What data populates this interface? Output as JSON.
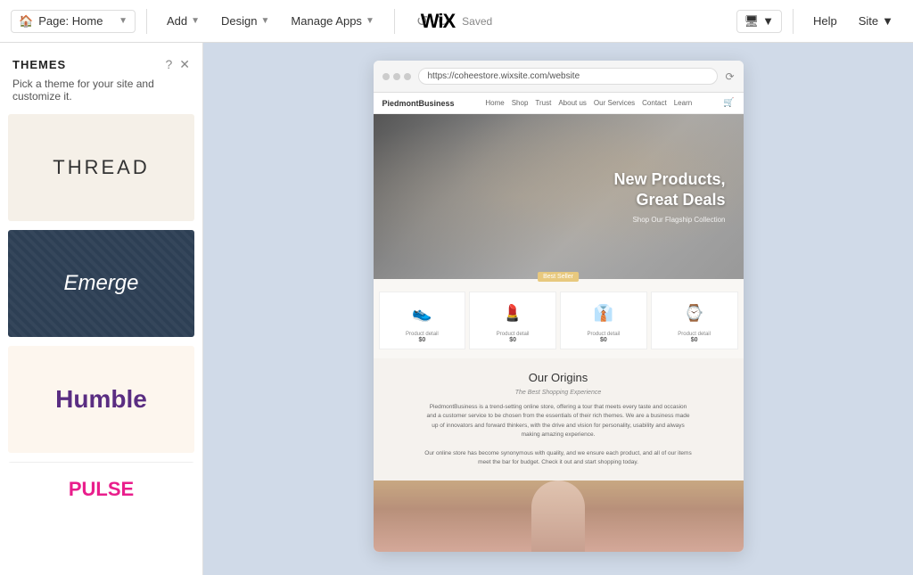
{
  "topbar": {
    "page_label": "Page: Home",
    "page_icon": "🏠",
    "add_label": "Add",
    "design_label": "Design",
    "manage_apps_label": "Manage Apps",
    "wix_logo": "WiX",
    "saved_label": "Saved",
    "help_label": "Help",
    "site_label": "Site"
  },
  "themes_panel": {
    "title": "THEMES",
    "subtitle": "Pick a theme for your site and customize it.",
    "cards": [
      {
        "id": "thread",
        "label": "THREAD",
        "style": "thread"
      },
      {
        "id": "emerge",
        "label": "Emerge",
        "style": "emerge"
      },
      {
        "id": "humble",
        "label": "Humble",
        "style": "humble"
      },
      {
        "id": "pulse",
        "label": "PULSE",
        "style": "pulse"
      }
    ]
  },
  "browser": {
    "url": "https://coheestore.wixsite.com/website"
  },
  "site_preview": {
    "brand": "PiedmontBusiness",
    "nav_links": [
      "Home",
      "Shop",
      "Trust",
      "About us",
      "Our Services",
      "Contact",
      "Learn"
    ],
    "hero_title": "New Products,\nGreat Deals",
    "hero_sub": "Shop Our Flagship Collection",
    "badge_label": "Best Seller",
    "products": [
      {
        "icon": "👟",
        "label": "Product detail",
        "price": "$0"
      },
      {
        "icon": "💄",
        "label": "Product detail",
        "price": "$0"
      },
      {
        "icon": "👔",
        "label": "Product detail",
        "price": "$0"
      },
      {
        "icon": "⌚",
        "label": "Product detail",
        "price": "$0"
      }
    ],
    "origins_title": "Our Origins",
    "origins_subtitle": "The Best Shopping Experience",
    "origins_text": "PiedmontBusiness is a trend-setting online store, offering a tour that meets every taste and occasion and a customer service to be chosen from the essentials of their rich themes. We are a business made up of innovators and forward thinkers, with the drive and vision for personality, usability and always making amazing experience.\n\nOur online store has become synonymous with quality, and we ensure each product, and all of our items meet the bar for budget. Check it out and start shopping today."
  }
}
